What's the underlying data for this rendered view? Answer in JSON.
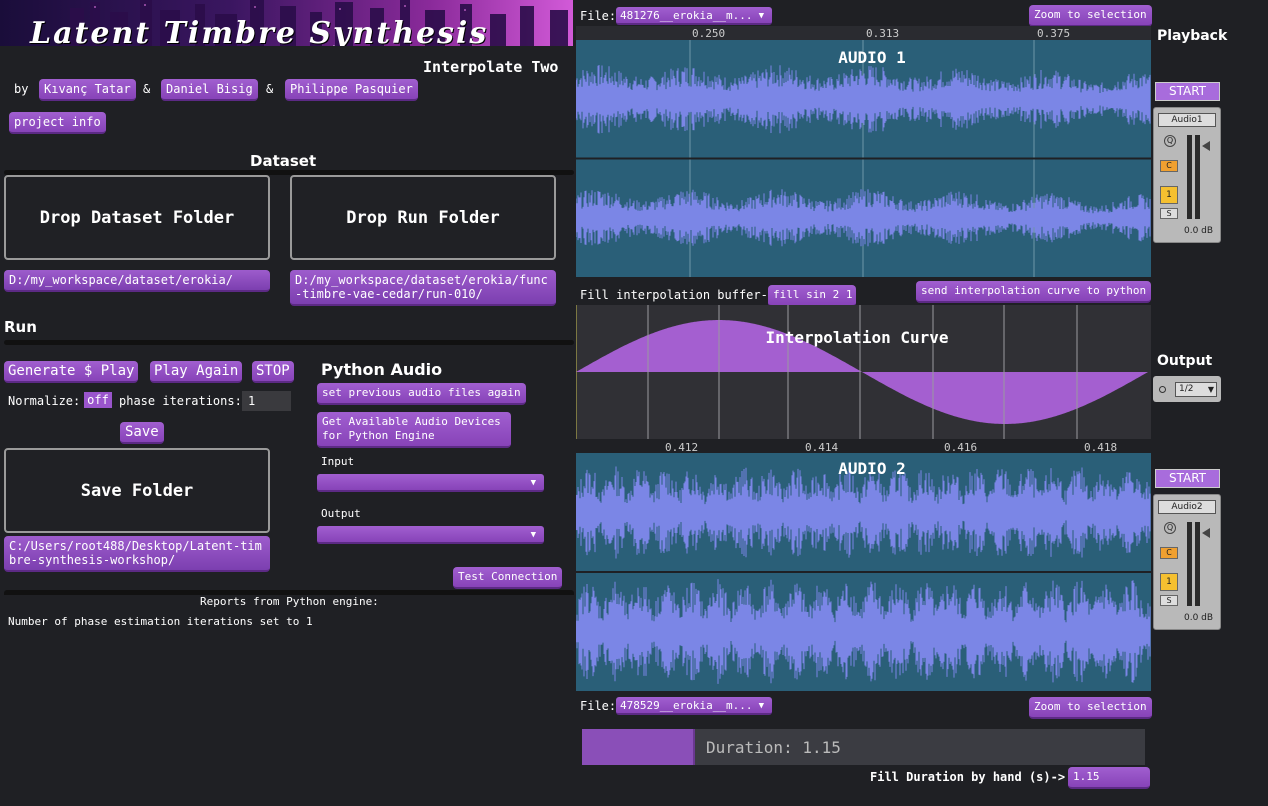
{
  "header": {
    "title": "Latent Timbre Synthesis",
    "subtitle": "Interpolate Two",
    "by_label": "by",
    "amp1": "&",
    "amp2": "&",
    "authors": [
      "Kıvanç Tatar",
      "Daniel Bisig",
      "Philippe Pasquier"
    ],
    "project_info": "project info"
  },
  "dataset": {
    "title": "Dataset",
    "drop_dataset": "Drop Dataset Folder",
    "drop_run": "Drop Run Folder",
    "dataset_path": "D:/my_workspace/dataset/erokia/",
    "run_path": "D:/my_workspace/dataset/erokia/func-timbre-vae-cedar/run-010/"
  },
  "run": {
    "title": "Run",
    "generate": "Generate $ Play",
    "play_again": "Play Again",
    "stop": "STOP",
    "normalize_label": "Normalize:",
    "normalize_value": "off",
    "phase_label": "phase iterations:",
    "phase_value": "1",
    "save": "Save",
    "save_folder": "Save Folder",
    "save_path": "C:/Users/root488/Desktop/Latent-timbre-synthesis-workshop/"
  },
  "python_audio": {
    "title": "Python Audio",
    "set_previous": "set previous audio files again",
    "get_devices": "Get Available Audio Devices for Python Engine",
    "input_label": "Input",
    "input_value": "",
    "output_label": "Output",
    "output_value": "",
    "test_connection": "Test Connection"
  },
  "reports": {
    "title": "Reports from Python engine:",
    "message": "Number of phase estimation iterations set to 1"
  },
  "audio1": {
    "file_label": "File:",
    "file_value": "481276__erokia__m...",
    "zoom": "Zoom to selection",
    "title": "AUDIO 1",
    "ticks": [
      "0.250",
      "0.313",
      "0.375"
    ]
  },
  "interp": {
    "fill_label": "Fill interpolation buffer->",
    "fill_value": "fill sin 2 1",
    "send": "send interpolation curve to python",
    "title": "Interpolation Curve",
    "ticks": [
      "0.412",
      "0.414",
      "0.416",
      "0.418"
    ]
  },
  "audio2": {
    "title": "AUDIO 2",
    "file_label": "File:",
    "file_value": "478529__erokia__m...",
    "zoom": "Zoom to selection"
  },
  "duration": {
    "label": "Duration: 1.15",
    "fill_label": "Fill Duration by hand (s)->",
    "fill_value": "1.15",
    "fraction": 0.2
  },
  "right": {
    "playback": "Playback",
    "start1": "START",
    "mixer1_name": "Audio1",
    "output": "Output",
    "output_select": "1/2",
    "start2": "START",
    "mixer2_name": "Audio2",
    "q": "Q",
    "c": "C",
    "one": "1",
    "s": "S",
    "db": "0.0 dB"
  },
  "colors": {
    "accent": "#9a55cc",
    "wave_bg": "#2a5f78",
    "wave": "#7b86e6",
    "curve": "#a45fd0"
  }
}
